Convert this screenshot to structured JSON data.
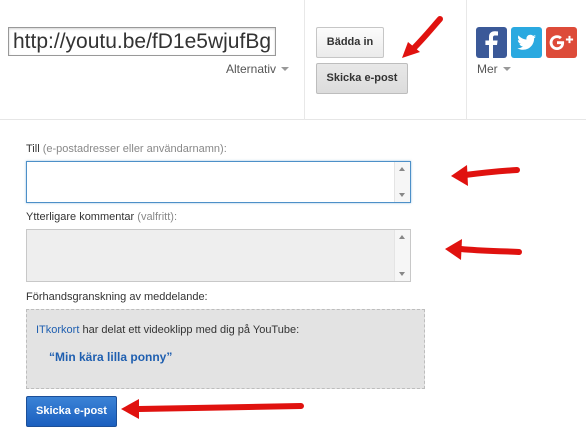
{
  "share": {
    "url_value": "http://youtu.be/fD1e5wjufBg",
    "options_label": "Alternativ",
    "embed_label": "Bädda in",
    "email_label": "Skicka e-post",
    "more_label": "Mer",
    "social": [
      {
        "icon": "facebook-icon",
        "glyph": "f",
        "color": "#3b5998"
      },
      {
        "icon": "twitter-icon",
        "glyph": "t",
        "color": "#2aa9e0"
      },
      {
        "icon": "google-plus-icon",
        "glyph": "g+",
        "color": "#dd4b39"
      }
    ]
  },
  "form": {
    "to_label": "Till",
    "to_hint": "(e-postadresser eller användarnamn):",
    "to_value": "",
    "comment_label": "Ytterligare kommentar",
    "comment_hint": "(valfritt):",
    "comment_value": "",
    "preview_label": "Förhandsgranskning av meddelande:",
    "preview_user": "ITkorkort",
    "preview_text": " har delat ett videoklipp med dig på YouTube:",
    "video_title": "“Min kära lilla ponny”",
    "send_label": "Skicka e-post"
  },
  "annotation": {
    "arrow_icon": "red-arrow-icon",
    "arrow_color": "#e0120f"
  }
}
